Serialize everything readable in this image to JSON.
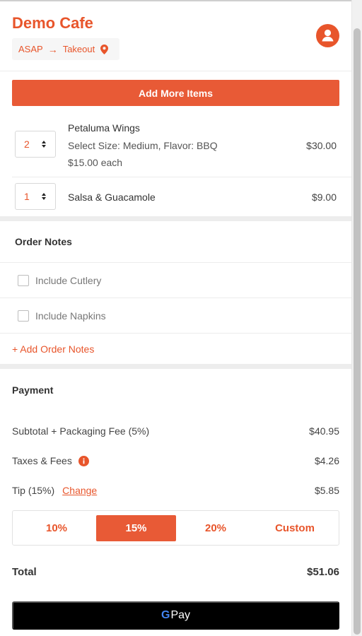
{
  "header": {
    "cafe_name": "Demo Cafe",
    "timing": "ASAP",
    "arrow": "→",
    "order_type": "Takeout"
  },
  "actions": {
    "add_more_items": "Add More Items"
  },
  "cart": {
    "items": [
      {
        "quantity": "2",
        "name": "Petaluma Wings",
        "options": "Select Size: Medium, Flavor: BBQ",
        "unit_price": "$15.00 each",
        "price": "$30.00"
      },
      {
        "quantity": "1",
        "name": "Salsa & Guacamole",
        "price": "$9.00"
      }
    ]
  },
  "order_notes": {
    "title": "Order Notes",
    "include_cutlery": "Include Cutlery",
    "include_napkins": "Include Napkins",
    "add_notes": "+ Add Order Notes"
  },
  "payment": {
    "title": "Payment",
    "subtotal_label": "Subtotal + Packaging Fee (5%)",
    "subtotal_value": "$40.95",
    "taxes_label": "Taxes & Fees",
    "taxes_value": "$4.26",
    "tip_label": "Tip (15%)",
    "tip_change": "Change",
    "tip_value": "$5.85",
    "tip_options": [
      "10%",
      "15%",
      "20%",
      "Custom"
    ],
    "tip_selected": "15%",
    "total_label": "Total",
    "total_value": "$51.06",
    "gpay_label": "Pay",
    "gpay_g": "G"
  },
  "colors": {
    "accent": "#e8552b",
    "button": "#e85a36",
    "gpay_button": "#000000"
  },
  "icons": [
    "user-avatar-icon",
    "location-pin-icon",
    "arrow-right-icon",
    "updown-caret-icon",
    "info-icon",
    "google-g-icon"
  ]
}
